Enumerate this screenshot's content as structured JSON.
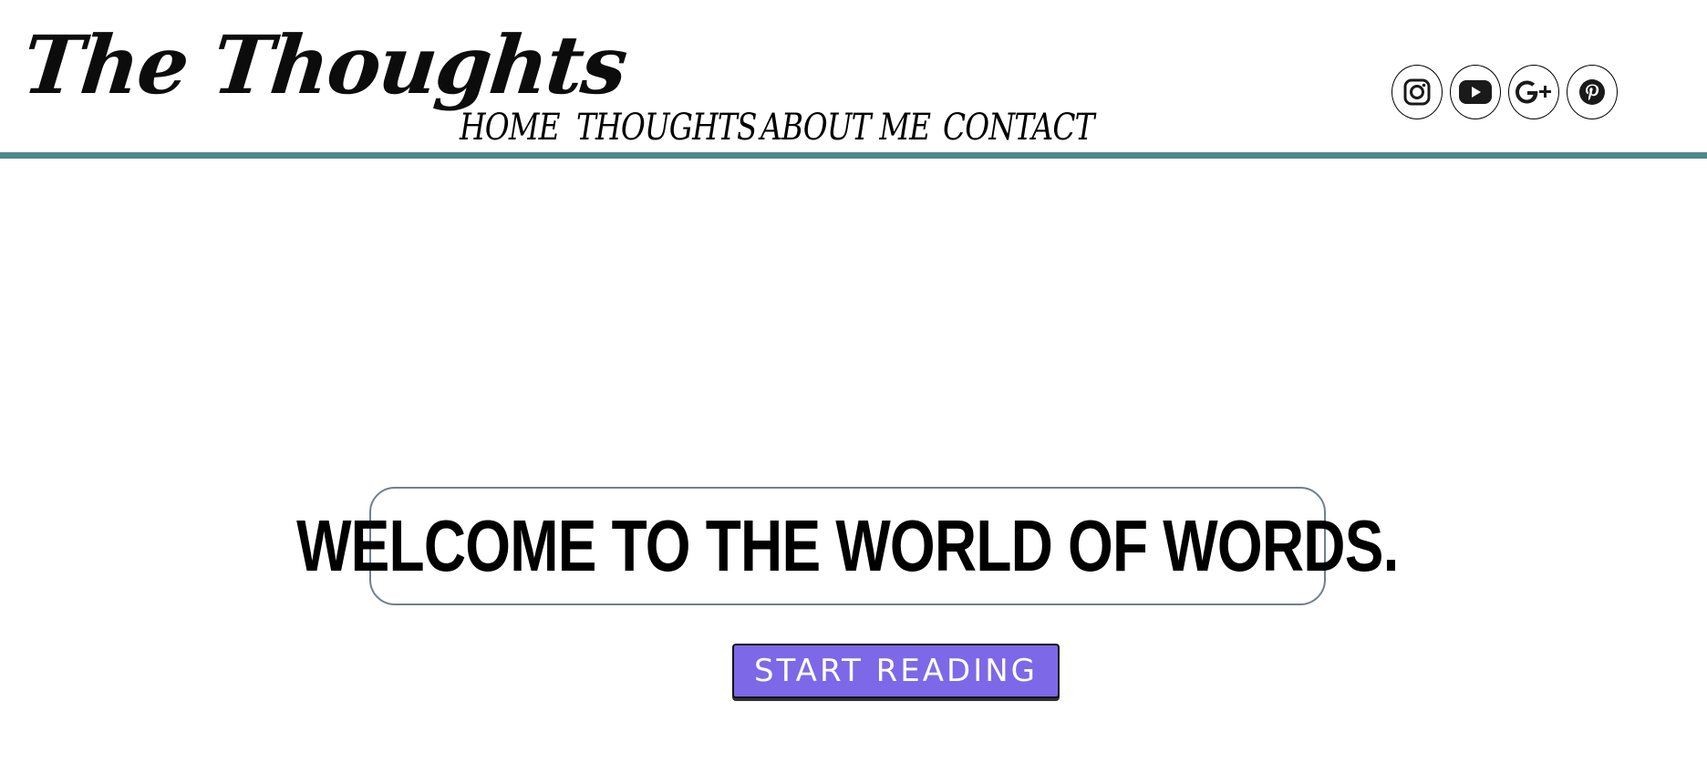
{
  "header": {
    "logo_text": "The Thoughts",
    "nav": [
      {
        "label": "HOME"
      },
      {
        "label": "THOUGHTS"
      },
      {
        "label": "ABOUT ME"
      },
      {
        "label": "CONTACT"
      }
    ],
    "social": [
      {
        "icon": "instagram-icon"
      },
      {
        "icon": "youtube-icon"
      },
      {
        "icon": "google-plus-icon"
      },
      {
        "icon": "pinterest-icon"
      }
    ]
  },
  "hero": {
    "title": "WELCOME TO THE WORLD OF WORDS.",
    "cta_label": "START READING"
  },
  "colors": {
    "divider": "#4f878d",
    "cta_background": "#7d68e8",
    "hero_border": "#6f8091"
  }
}
